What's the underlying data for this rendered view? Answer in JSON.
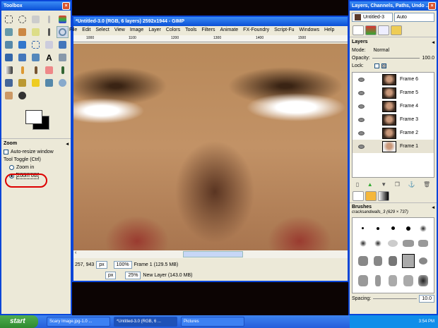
{
  "toolbox": {
    "title": "Toolbox",
    "options_title": "Zoom",
    "auto_resize": "Auto-resize window",
    "tool_toggle": "Tool Toggle  (Ctrl)",
    "zoom_in": "Zoom in",
    "zoom_out": "Zoom out"
  },
  "image_window": {
    "title": "*Untitled-3.0 (RGB, 6 layers) 2592x1944 - GIMP",
    "menu": [
      "File",
      "Edit",
      "Select",
      "View",
      "Image",
      "Layer",
      "Colors",
      "Tools",
      "Filters",
      "Animate",
      "FX-Foundry",
      "Script-Fu",
      "Windows",
      "Help"
    ],
    "ruler": [
      "1000",
      "1100",
      "1200",
      "1300",
      "1400",
      "1500"
    ],
    "coords": "257, 943",
    "unit": "px",
    "zoom": "100%",
    "status": "Frame 1 (129.5 MB)"
  },
  "image_window2": {
    "unit": "px",
    "zoom": "25%",
    "status": "New Layer (143.0 MB)"
  },
  "dock": {
    "title": "Layers, Channels, Paths, Undo ...",
    "image": "Untitled-3",
    "auto": "Auto",
    "layers_title": "Layers",
    "mode_label": "Mode:",
    "mode": "Normal",
    "opacity_label": "Opacity:",
    "opacity": "100.0",
    "lock_label": "Lock:",
    "layers": [
      "Frame 6",
      "Frame 5",
      "Frame 4",
      "Frame 3",
      "Frame 2",
      "Frame 1"
    ],
    "brushes_title": "Brushes",
    "brush_name": "cracksandwalls_3 (629 × 737)",
    "spacing_label": "Spacing:",
    "spacing": "10.0"
  },
  "taskbar": {
    "start": "start",
    "tasks": [
      "Scary Image.jpg-1.0 ...",
      "*Untitled-3.0 (RGB, 6 ...",
      "Pictures"
    ],
    "clock": "3:54 PM"
  }
}
